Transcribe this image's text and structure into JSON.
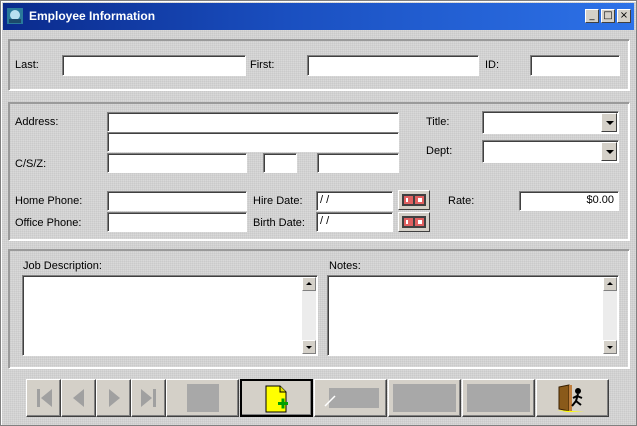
{
  "window": {
    "title": "Employee Information",
    "controls": {
      "minimize": "_",
      "maximize": "□",
      "close": "×"
    }
  },
  "name_section": {
    "last_label": "Last:",
    "first_label": "First:",
    "id_label": "ID:",
    "last_value": "",
    "first_value": "",
    "id_value": ""
  },
  "address_section": {
    "address_label": "Address:",
    "csz_label": "C/S/Z:",
    "title_label": "Title:",
    "dept_label": "Dept:",
    "home_phone_label": "Home Phone:",
    "office_phone_label": "Office Phone:",
    "hire_date_label": "Hire Date:",
    "birth_date_label": "Birth Date:",
    "rate_label": "Rate:",
    "hire_date_value": " / /",
    "birth_date_value": " / /",
    "rate_value": "$0.00",
    "title_value": "",
    "dept_value": ""
  },
  "notes_section": {
    "job_description_label": "Job Description:",
    "notes_label": "Notes:"
  },
  "toolbar": {
    "buttons": [
      "first-record",
      "previous-record",
      "next-record",
      "last-record",
      "delete",
      "new-record",
      "edit",
      "save",
      "cancel",
      "exit"
    ],
    "disabled": [
      "first-record",
      "previous-record",
      "next-record",
      "last-record",
      "delete",
      "edit",
      "save",
      "cancel"
    ]
  },
  "colors": {
    "titlebar_start": "#0a2a8c",
    "titlebar_end": "#2d72e8",
    "new_icon": "#ffff00",
    "plus": "#00a000"
  }
}
